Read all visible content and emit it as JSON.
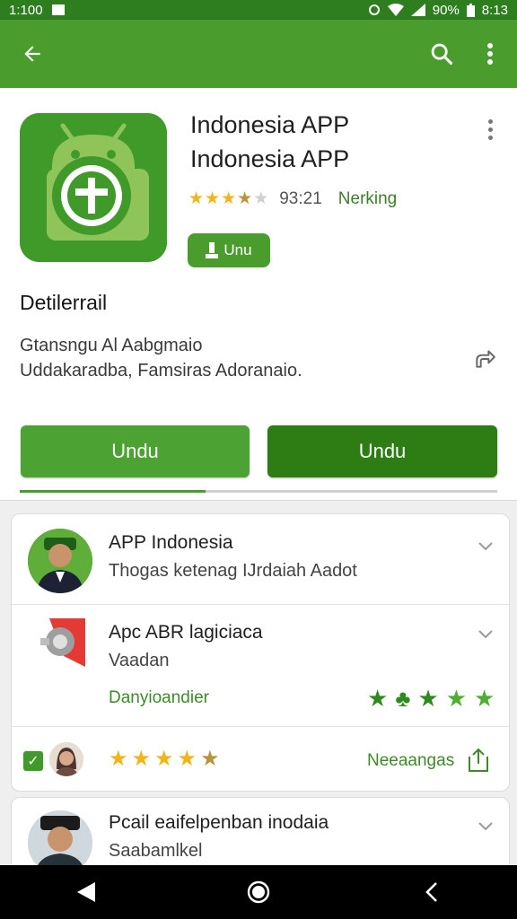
{
  "status_bar": {
    "time": "1:100",
    "battery": "90%",
    "clock": "8:13"
  },
  "app_bar": {
    "back_icon": "arrow-left-icon",
    "search_icon": "search-icon",
    "more_icon": "more-vert-icon"
  },
  "app": {
    "title": "Indonesia APP Indonesia APP",
    "rating_count": "93:21",
    "rating_status": "Nerking",
    "rating": 3.5,
    "install_chip_label": "Unu",
    "details_heading": "Detilerrail",
    "description_line1": "Gtansngu Al Aabgmaio",
    "description_line2": "Uddakaradba, Famsiras Adoranaio.",
    "button_left": "Undu",
    "button_right": "Undu",
    "progress": 0.39
  },
  "list": [
    {
      "title": "APP Indonesia",
      "subtitle": "Thogas ketenag IJrdaiah Aadot"
    },
    {
      "title": "Apc ABR lagiciaca",
      "subtitle": "Vaadan",
      "link": "Danyioandier",
      "check_rating": 4.5,
      "footer_link": "Neeaangas"
    },
    {
      "title": "Pcail eaifelpenban inodaia",
      "subtitle": "Saabamlkel"
    }
  ],
  "nav_bar": {
    "back_icon": "triangle-back-icon",
    "home_icon": "circle-home-icon",
    "recent_icon": "chevron-left-icon"
  },
  "colors": {
    "primary": "#4a9c2d",
    "primary_dark": "#2d7d14",
    "star": "#f2b418"
  }
}
